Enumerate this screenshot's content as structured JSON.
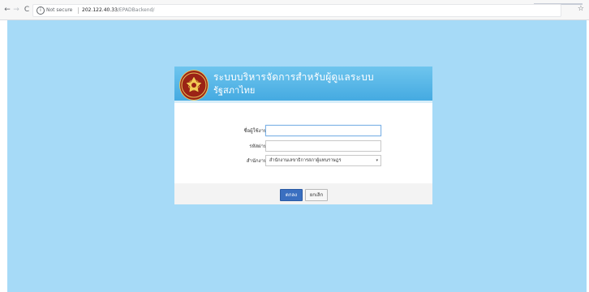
{
  "browser": {
    "back_icon": "arrow-left-icon",
    "back_glyph": "←",
    "forward_icon": "arrow-right-icon",
    "forward_glyph": "→",
    "reload_icon": "reload-icon",
    "reload_glyph": "C",
    "info_icon": "info-icon",
    "info_glyph": "i",
    "security_label": "Not secure",
    "url_host": "202.122.40.33",
    "url_path": "/EPADBackend/",
    "bookmark_icon": "star-icon",
    "bookmark_glyph": "☆"
  },
  "page": {
    "background_color": "#a6daf7",
    "header": {
      "emblem_icon": "parliament-emblem-icon",
      "title": "ระบบบริหารจัดการสำหรับผู้ดูแลระบบ",
      "subtitle": "รัฐสภาไทย"
    },
    "form": {
      "username_label": "ชื่อผู้ใช้งาน :",
      "username_value": "",
      "password_label": "รหัสผ่าน :",
      "password_value": "",
      "office_label": "สำนักงาน :",
      "office_selected": "สำนักงานเลขาธิการสภาผู้แทนราษฎร",
      "office_arrow_icon": "dropdown-arrow-icon",
      "office_arrow_glyph": "▾"
    },
    "buttons": {
      "submit_label": "ตกลง",
      "cancel_label": "ยกเลิก"
    },
    "colors": {
      "header_top": "#6fc5ee",
      "header_bottom": "#42a8e0",
      "submit_button": "#3a6fc0"
    }
  }
}
